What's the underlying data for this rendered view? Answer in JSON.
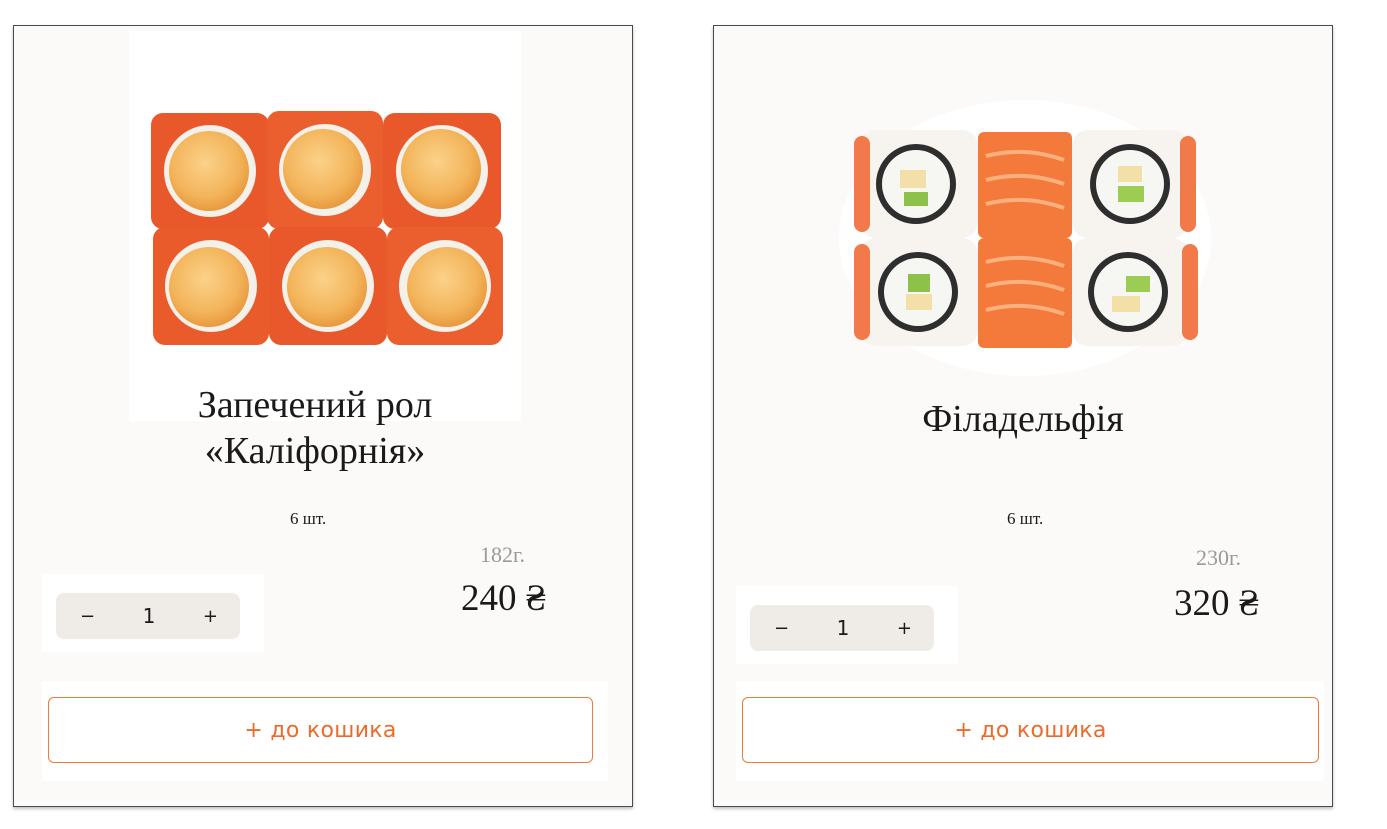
{
  "products": [
    {
      "image": "baked-california-roll-photo",
      "title_line1": "Запечений рол",
      "title_line2": "«Каліфорнія»",
      "pieces": "6  шт.",
      "weight": "182г.",
      "price": "240 ₴",
      "qty_minus": "−",
      "qty_value": "1",
      "qty_plus": "+",
      "add_to_cart": "+ до кошика"
    },
    {
      "image": "philadelphia-roll-photo",
      "title_line1": "Філадельфія",
      "title_line2": "",
      "pieces": "6 шт.",
      "weight": "230г.",
      "price": "320 ₴",
      "qty_minus": "−",
      "qty_value": "1",
      "qty_plus": "+",
      "add_to_cart": "+ до кошика"
    }
  ],
  "colors": {
    "accent": "#ee6a28",
    "card_bg": "#fcfaf8",
    "stepper_bg": "#efebe6",
    "weight_text": "#9a9a9a"
  }
}
